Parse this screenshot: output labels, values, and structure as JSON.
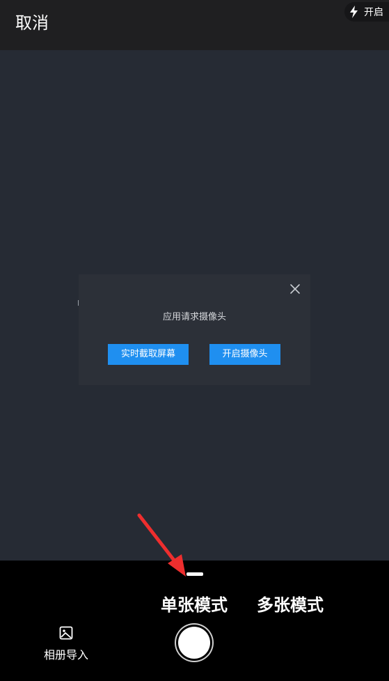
{
  "header": {
    "cancel_label": "取消",
    "flash_label": "开启",
    "flash_icon": "lightning-icon"
  },
  "dialog": {
    "title": "应用请求摄像头",
    "close_icon": "close-icon",
    "screen_capture_label": "实时截取屏幕",
    "open_camera_label": "开启摄像头",
    "button_color": "#1f8ff0"
  },
  "bottom": {
    "modes": {
      "single": "单张模式",
      "multi": "多张模式"
    },
    "active_mode": "单张模式",
    "album_label": "相册导入",
    "album_icon": "image-icon",
    "shutter_icon": "shutter-button"
  },
  "annotation": {
    "arrow_color": "#ee2e2e"
  }
}
